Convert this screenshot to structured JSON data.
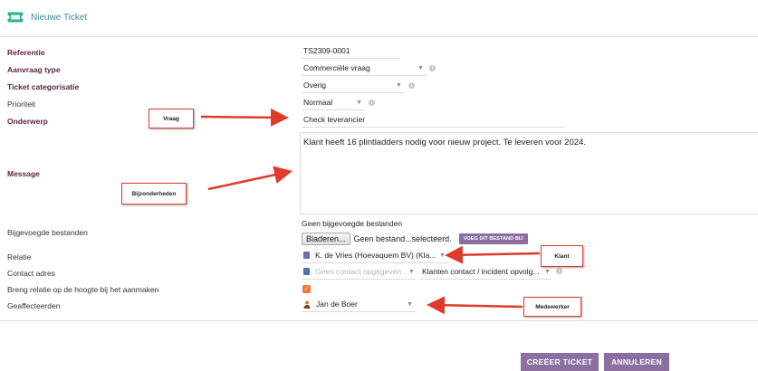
{
  "header": {
    "title": "Nieuwe Ticket",
    "icon": "ticket-icon"
  },
  "form": {
    "referentie": {
      "label": "Referentie",
      "value": "TS2309-0001"
    },
    "aanvraag_type": {
      "label": "Aanvraag type",
      "value": "Commerciële vraag"
    },
    "ticket_categorisatie": {
      "label": "Ticket categorisatie",
      "value": "Overig"
    },
    "prioriteit": {
      "label": "Prioriteit",
      "value": "Normaal"
    },
    "onderwerp": {
      "label": "Onderwerp",
      "value": "Check leverancier"
    },
    "message": {
      "label": "Message",
      "value": "Klant heeft 16 plintladders nodig voor nieuw project. Te leveren voor 2024."
    },
    "bijgevoegde_bestanden": {
      "label": "Bijgevoegde bestanden",
      "status": "Geen bijgevoegde bestanden",
      "browse_button": "Bladeren...",
      "file_status": "Geen bestand...selecteerd.",
      "attach_button": "VOEG DIT BESTAND BIJ"
    },
    "relatie": {
      "label": "Relatie",
      "value": "K. de Vries (Hoevaquem BV) (Kla..."
    },
    "contact_adres": {
      "label": "Contact adres",
      "placeholder": "Geen contact opgegeven ...",
      "role_value": "Klanten contact / incident opvolg..."
    },
    "notify": {
      "label": "Breng relatie op de hoogte bij het aanmaken",
      "checked": true
    },
    "geaffecteerden": {
      "label": "Geaffecteerden",
      "value": "Jan de Boer"
    }
  },
  "annotations": {
    "vraag": "Vraag",
    "bijzonderheden": "Bijzonderheden",
    "klant": "Klant",
    "medewerker": "Medewerker"
  },
  "actions": {
    "create": "CREËER TICKET",
    "cancel": "ANNULEREN"
  },
  "colors": {
    "accent": "#8b6fa0",
    "label_required": "#5b2149",
    "header_teal": "#3a8aa6",
    "annotation_red": "#e03a2a",
    "checkbox_orange": "#f0743c"
  }
}
